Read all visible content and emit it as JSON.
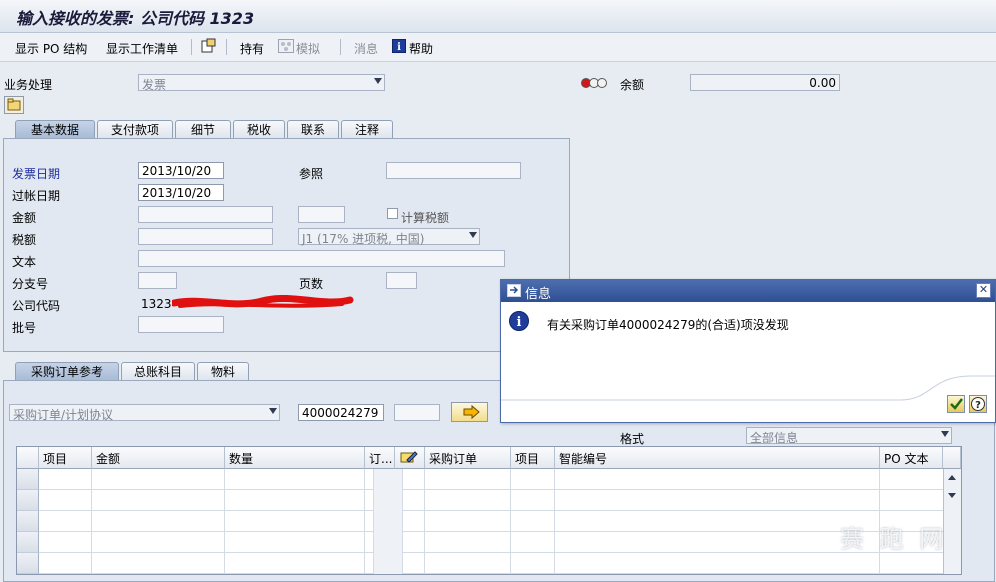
{
  "title": "输入接收的发票: 公司代码 1323",
  "toolbar": {
    "show_po_structure": "显示 PO 结构",
    "show_worklist": "显示工作清单",
    "hold": "持有",
    "simulate": "模拟",
    "messages": "消息",
    "help": "帮助"
  },
  "header": {
    "transaction_label": "业务处理",
    "transaction_value": "发票",
    "balance_label": "余额",
    "balance_value": "0.00"
  },
  "tabs_top": [
    "基本数据",
    "支付款项",
    "细节",
    "税收",
    "联系",
    "注释"
  ],
  "basic": {
    "invoice_date_label": "发票日期",
    "invoice_date_value": "2013/10/20",
    "reference_label": "参照",
    "posting_date_label": "过帐日期",
    "posting_date_value": "2013/10/20",
    "amount_label": "金额",
    "calc_tax_label": "计算税额",
    "tax_label": "税额",
    "tax_code_value": "J1 (17% 进项税, 中国)",
    "text_label": "文本",
    "branch_label": "分支号",
    "pages_label": "页数",
    "company_label": "公司代码",
    "company_value": "1323",
    "batch_label": "批号"
  },
  "tabs_bottom": [
    "采购订单参考",
    "总账科目",
    "物料"
  ],
  "po_ref": {
    "ref_type_value": "采购订单/计划协议",
    "po_number_value": "4000024279",
    "layout_label": "格式",
    "layout_value": "全部信息"
  },
  "grid": {
    "columns": [
      "项目",
      "金额",
      "数量",
      "订...",
      "",
      "采购订单",
      "项目",
      "智能编号",
      "PO 文本"
    ]
  },
  "dialog": {
    "title": "信息",
    "message": "有关采购订单4000024279的(合适)项没发现"
  },
  "watermark": "赛 跑 网",
  "colors": {
    "accent": "#2f4f94",
    "traffic_red": "#d01818"
  }
}
